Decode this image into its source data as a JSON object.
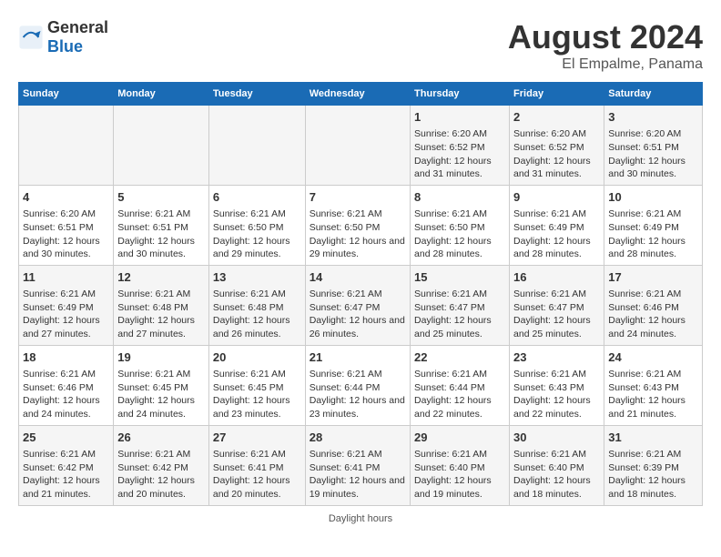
{
  "logo": {
    "general": "General",
    "blue": "Blue"
  },
  "title": "August 2024",
  "subtitle": "El Empalme, Panama",
  "weekdays": [
    "Sunday",
    "Monday",
    "Tuesday",
    "Wednesday",
    "Thursday",
    "Friday",
    "Saturday"
  ],
  "footer": "Daylight hours",
  "weeks": [
    [
      {
        "day": "",
        "sunrise": "",
        "sunset": "",
        "daylight": ""
      },
      {
        "day": "",
        "sunrise": "",
        "sunset": "",
        "daylight": ""
      },
      {
        "day": "",
        "sunrise": "",
        "sunset": "",
        "daylight": ""
      },
      {
        "day": "",
        "sunrise": "",
        "sunset": "",
        "daylight": ""
      },
      {
        "day": "1",
        "sunrise": "Sunrise: 6:20 AM",
        "sunset": "Sunset: 6:52 PM",
        "daylight": "Daylight: 12 hours and 31 minutes."
      },
      {
        "day": "2",
        "sunrise": "Sunrise: 6:20 AM",
        "sunset": "Sunset: 6:52 PM",
        "daylight": "Daylight: 12 hours and 31 minutes."
      },
      {
        "day": "3",
        "sunrise": "Sunrise: 6:20 AM",
        "sunset": "Sunset: 6:51 PM",
        "daylight": "Daylight: 12 hours and 30 minutes."
      }
    ],
    [
      {
        "day": "4",
        "sunrise": "Sunrise: 6:20 AM",
        "sunset": "Sunset: 6:51 PM",
        "daylight": "Daylight: 12 hours and 30 minutes."
      },
      {
        "day": "5",
        "sunrise": "Sunrise: 6:21 AM",
        "sunset": "Sunset: 6:51 PM",
        "daylight": "Daylight: 12 hours and 30 minutes."
      },
      {
        "day": "6",
        "sunrise": "Sunrise: 6:21 AM",
        "sunset": "Sunset: 6:50 PM",
        "daylight": "Daylight: 12 hours and 29 minutes."
      },
      {
        "day": "7",
        "sunrise": "Sunrise: 6:21 AM",
        "sunset": "Sunset: 6:50 PM",
        "daylight": "Daylight: 12 hours and 29 minutes."
      },
      {
        "day": "8",
        "sunrise": "Sunrise: 6:21 AM",
        "sunset": "Sunset: 6:50 PM",
        "daylight": "Daylight: 12 hours and 28 minutes."
      },
      {
        "day": "9",
        "sunrise": "Sunrise: 6:21 AM",
        "sunset": "Sunset: 6:49 PM",
        "daylight": "Daylight: 12 hours and 28 minutes."
      },
      {
        "day": "10",
        "sunrise": "Sunrise: 6:21 AM",
        "sunset": "Sunset: 6:49 PM",
        "daylight": "Daylight: 12 hours and 28 minutes."
      }
    ],
    [
      {
        "day": "11",
        "sunrise": "Sunrise: 6:21 AM",
        "sunset": "Sunset: 6:49 PM",
        "daylight": "Daylight: 12 hours and 27 minutes."
      },
      {
        "day": "12",
        "sunrise": "Sunrise: 6:21 AM",
        "sunset": "Sunset: 6:48 PM",
        "daylight": "Daylight: 12 hours and 27 minutes."
      },
      {
        "day": "13",
        "sunrise": "Sunrise: 6:21 AM",
        "sunset": "Sunset: 6:48 PM",
        "daylight": "Daylight: 12 hours and 26 minutes."
      },
      {
        "day": "14",
        "sunrise": "Sunrise: 6:21 AM",
        "sunset": "Sunset: 6:47 PM",
        "daylight": "Daylight: 12 hours and 26 minutes."
      },
      {
        "day": "15",
        "sunrise": "Sunrise: 6:21 AM",
        "sunset": "Sunset: 6:47 PM",
        "daylight": "Daylight: 12 hours and 25 minutes."
      },
      {
        "day": "16",
        "sunrise": "Sunrise: 6:21 AM",
        "sunset": "Sunset: 6:47 PM",
        "daylight": "Daylight: 12 hours and 25 minutes."
      },
      {
        "day": "17",
        "sunrise": "Sunrise: 6:21 AM",
        "sunset": "Sunset: 6:46 PM",
        "daylight": "Daylight: 12 hours and 24 minutes."
      }
    ],
    [
      {
        "day": "18",
        "sunrise": "Sunrise: 6:21 AM",
        "sunset": "Sunset: 6:46 PM",
        "daylight": "Daylight: 12 hours and 24 minutes."
      },
      {
        "day": "19",
        "sunrise": "Sunrise: 6:21 AM",
        "sunset": "Sunset: 6:45 PM",
        "daylight": "Daylight: 12 hours and 24 minutes."
      },
      {
        "day": "20",
        "sunrise": "Sunrise: 6:21 AM",
        "sunset": "Sunset: 6:45 PM",
        "daylight": "Daylight: 12 hours and 23 minutes."
      },
      {
        "day": "21",
        "sunrise": "Sunrise: 6:21 AM",
        "sunset": "Sunset: 6:44 PM",
        "daylight": "Daylight: 12 hours and 23 minutes."
      },
      {
        "day": "22",
        "sunrise": "Sunrise: 6:21 AM",
        "sunset": "Sunset: 6:44 PM",
        "daylight": "Daylight: 12 hours and 22 minutes."
      },
      {
        "day": "23",
        "sunrise": "Sunrise: 6:21 AM",
        "sunset": "Sunset: 6:43 PM",
        "daylight": "Daylight: 12 hours and 22 minutes."
      },
      {
        "day": "24",
        "sunrise": "Sunrise: 6:21 AM",
        "sunset": "Sunset: 6:43 PM",
        "daylight": "Daylight: 12 hours and 21 minutes."
      }
    ],
    [
      {
        "day": "25",
        "sunrise": "Sunrise: 6:21 AM",
        "sunset": "Sunset: 6:42 PM",
        "daylight": "Daylight: 12 hours and 21 minutes."
      },
      {
        "day": "26",
        "sunrise": "Sunrise: 6:21 AM",
        "sunset": "Sunset: 6:42 PM",
        "daylight": "Daylight: 12 hours and 20 minutes."
      },
      {
        "day": "27",
        "sunrise": "Sunrise: 6:21 AM",
        "sunset": "Sunset: 6:41 PM",
        "daylight": "Daylight: 12 hours and 20 minutes."
      },
      {
        "day": "28",
        "sunrise": "Sunrise: 6:21 AM",
        "sunset": "Sunset: 6:41 PM",
        "daylight": "Daylight: 12 hours and 19 minutes."
      },
      {
        "day": "29",
        "sunrise": "Sunrise: 6:21 AM",
        "sunset": "Sunset: 6:40 PM",
        "daylight": "Daylight: 12 hours and 19 minutes."
      },
      {
        "day": "30",
        "sunrise": "Sunrise: 6:21 AM",
        "sunset": "Sunset: 6:40 PM",
        "daylight": "Daylight: 12 hours and 18 minutes."
      },
      {
        "day": "31",
        "sunrise": "Sunrise: 6:21 AM",
        "sunset": "Sunset: 6:39 PM",
        "daylight": "Daylight: 12 hours and 18 minutes."
      }
    ]
  ]
}
